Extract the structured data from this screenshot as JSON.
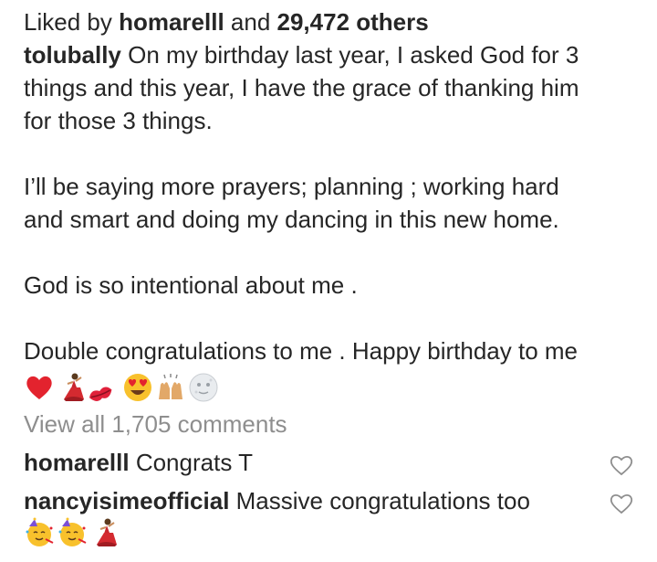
{
  "likes": {
    "prefix": "Liked by ",
    "user": "homarelll",
    "middle": " and ",
    "count": "29,472 others"
  },
  "caption": {
    "username": "tolubally",
    "line1_rest": " On my birthday last year, I asked God for 3",
    "line2": "things and this year, I have the grace of thanking him",
    "line3": "for those 3 things.",
    "line4": "I’ll be saying more prayers; planning ; working hard",
    "line5": "and smart  and doing my dancing in this new home.",
    "line6": "God is so intentional about me .",
    "line7": "Double congratulations to me . Happy birthday to me",
    "emojis": [
      "red-heart",
      "dancer",
      "kiss-mark",
      "heart-eyes",
      "raised-hands",
      "full-moon-face"
    ]
  },
  "view_all_comments": "View all 1,705 comments",
  "comments": [
    {
      "username": "homarelll",
      "text": " Congrats T",
      "emojis": []
    },
    {
      "username": "nancyisimeofficial",
      "text": " Massive congratulations too",
      "emojis": [
        "partying-face",
        "partying-face",
        "dancer"
      ]
    }
  ],
  "colors": {
    "text": "#262626",
    "muted": "#8e8e8e",
    "heart_red": "#e8202a"
  }
}
